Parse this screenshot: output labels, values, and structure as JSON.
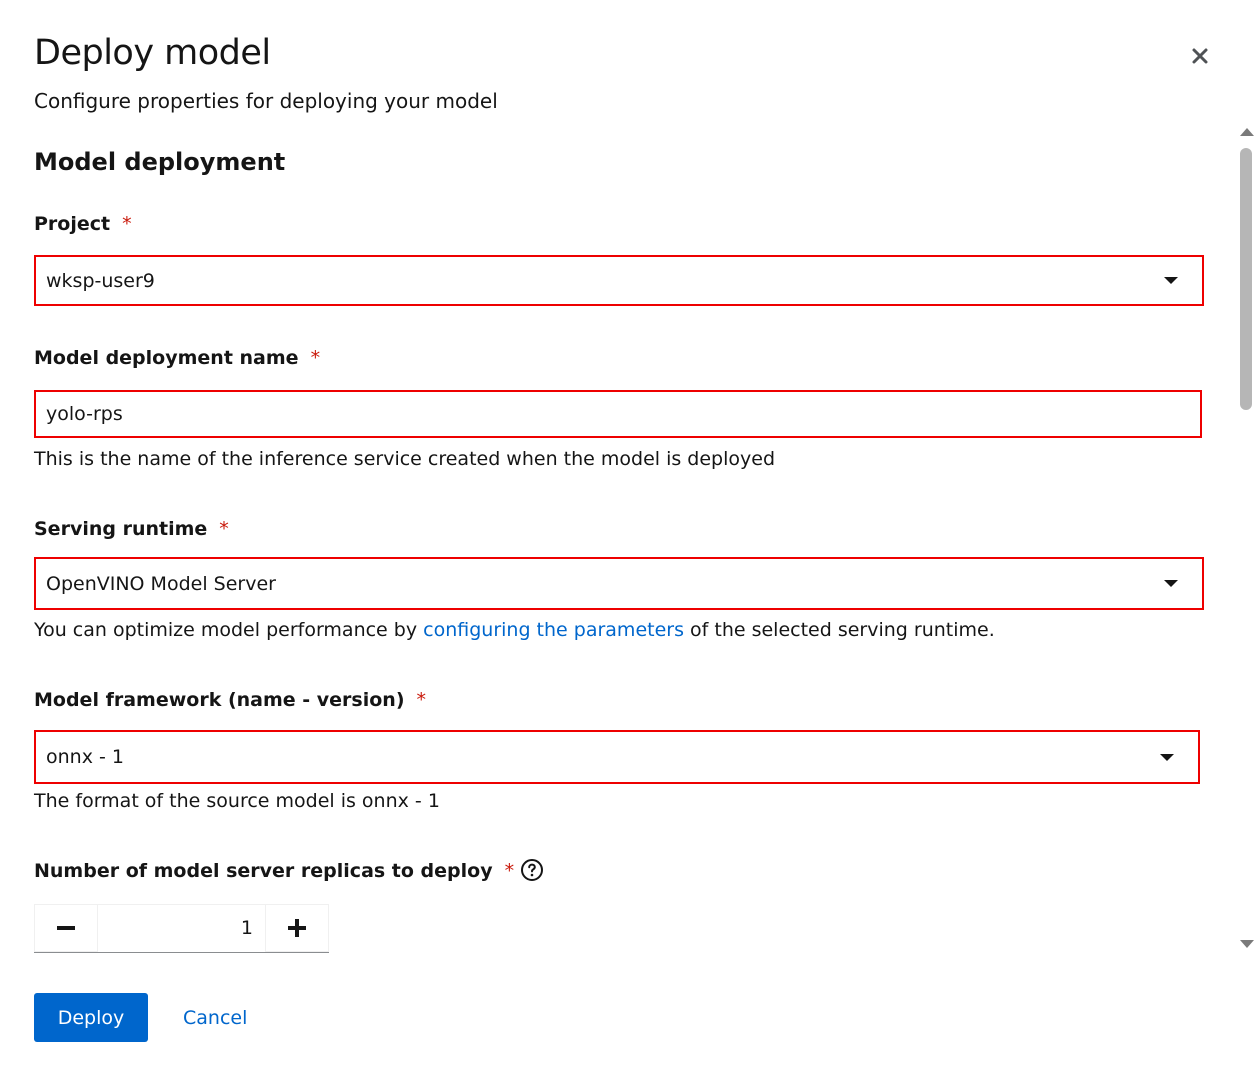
{
  "header": {
    "title": "Deploy model",
    "subtitle": "Configure properties for deploying your model",
    "close_icon": "close-icon"
  },
  "section": {
    "title": "Model deployment"
  },
  "fields": {
    "project": {
      "label": "Project",
      "required_mark": "*",
      "value": "wksp-user9"
    },
    "deployment_name": {
      "label": "Model deployment name",
      "required_mark": "*",
      "value": "yolo-rps",
      "helper": "This is the name of the inference service created when the model is deployed"
    },
    "serving_runtime": {
      "label": "Serving runtime",
      "required_mark": "*",
      "value": "OpenVINO Model Server",
      "helper_before": "You can optimize model performance by ",
      "helper_link": "configuring the parameters",
      "helper_after": " of the selected serving runtime."
    },
    "framework": {
      "label": "Model framework (name - version)",
      "required_mark": "*",
      "value": "onnx - 1",
      "helper": "The format of the source model is onnx - 1"
    },
    "replicas": {
      "label": "Number of model server replicas to deploy",
      "required_mark": "*",
      "value": "1",
      "help_icon": "question-circle-icon"
    }
  },
  "footer": {
    "deploy_label": "Deploy",
    "cancel_label": "Cancel"
  },
  "colors": {
    "primary": "#0066cc",
    "required": "#c9190b",
    "highlight_border": "#ee0000"
  }
}
